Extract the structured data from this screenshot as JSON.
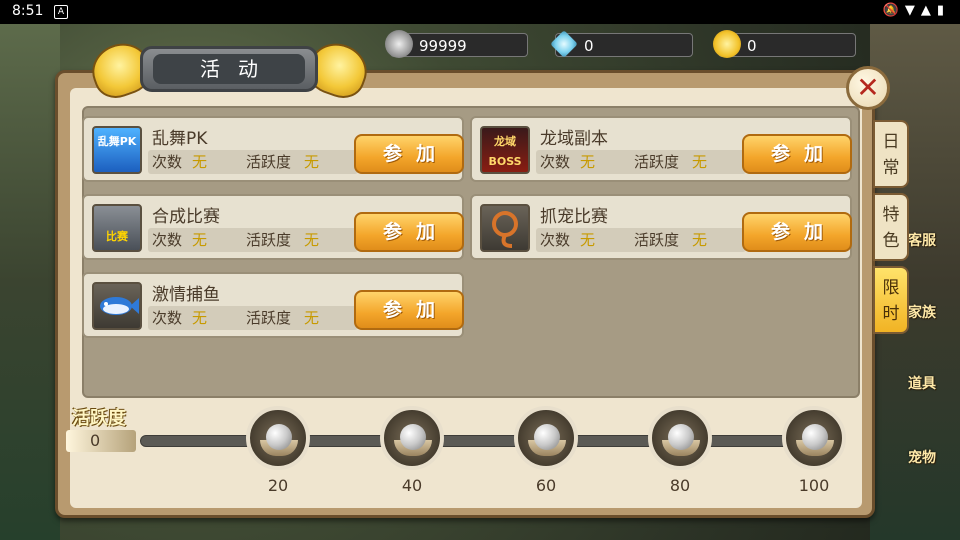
{
  "status_bar": {
    "time": "8:51",
    "app_icon_glyph": "A"
  },
  "currency": [
    {
      "icon": "silver-coin-icon",
      "value": "99999"
    },
    {
      "icon": "diamond-icon",
      "value": "0"
    },
    {
      "icon": "gold-coin-icon",
      "value": "0"
    }
  ],
  "window": {
    "title": "活动",
    "close_glyph": "✕"
  },
  "tabs": [
    {
      "label": "日常",
      "active": false
    },
    {
      "label": "特色",
      "active": false
    },
    {
      "label": "限时",
      "active": true
    }
  ],
  "activities": [
    {
      "name": "乱舞PK",
      "icon_text": "乱舞PK",
      "count_label": "次数",
      "count_value": "无",
      "activity_label": "活跃度",
      "activity_value": "无",
      "button": "参加"
    },
    {
      "name": "龙域副本",
      "icon_text": "龙域BOSS",
      "count_label": "次数",
      "count_value": "无",
      "activity_label": "活跃度",
      "activity_value": "无",
      "button": "参加"
    },
    {
      "name": "合成比赛",
      "icon_text": "比赛",
      "count_label": "次数",
      "count_value": "无",
      "activity_label": "活跃度",
      "activity_value": "无",
      "button": "参加"
    },
    {
      "name": "抓宠比赛",
      "icon_text": "",
      "count_label": "次数",
      "count_value": "无",
      "activity_label": "活跃度",
      "activity_value": "无",
      "button": "参加"
    },
    {
      "name": "激情捕鱼",
      "icon_text": "",
      "count_label": "次数",
      "count_value": "无",
      "activity_label": "活跃度",
      "activity_value": "无",
      "button": "参加"
    }
  ],
  "activity_progress": {
    "label": "活跃度",
    "value": "0",
    "progress_fraction": 0,
    "milestones": [
      "20",
      "40",
      "60",
      "80",
      "100"
    ]
  },
  "background_side_labels": [
    "客服",
    "家族",
    "道具",
    "宠物"
  ]
}
